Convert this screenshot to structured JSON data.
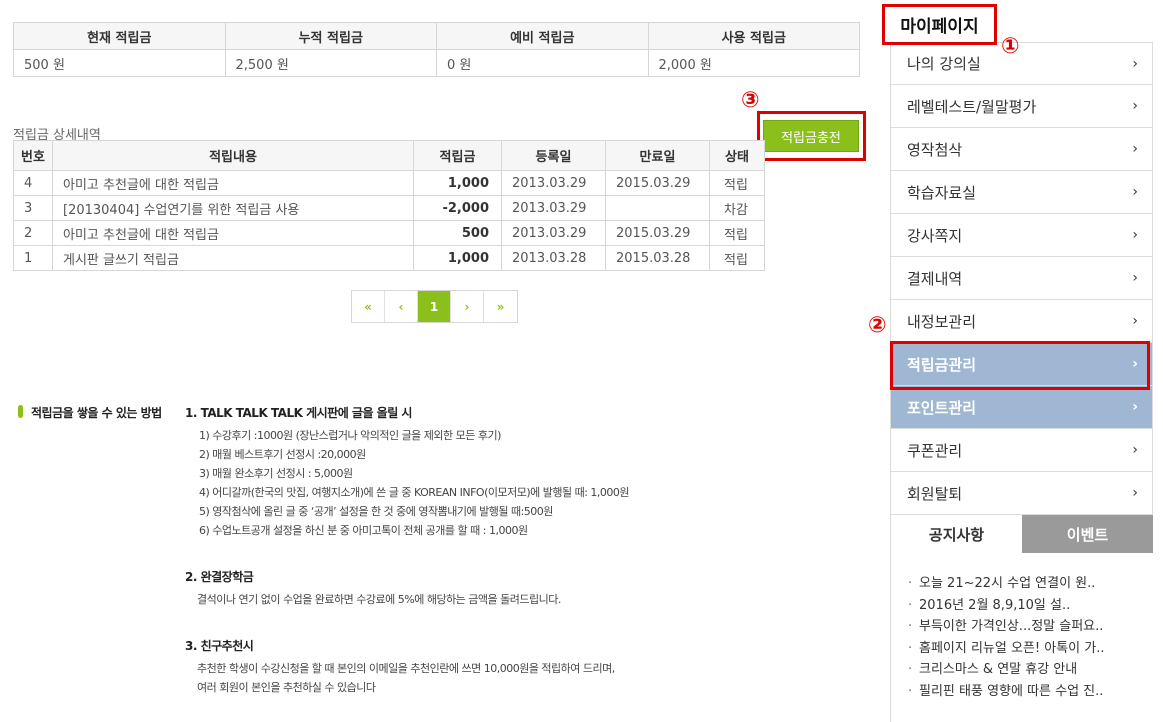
{
  "summary": {
    "headers": [
      "현재 적립금",
      "누적 적립금",
      "예비 적립금",
      "사용 적립금"
    ],
    "values": [
      "500 원",
      "2,500 원",
      "0 원",
      "2,000 원"
    ]
  },
  "detail": {
    "title": "적립금 상세내역",
    "charge_button": "적립금충전",
    "headers": [
      "번호",
      "적립내용",
      "적립금",
      "등록일",
      "만료일",
      "상태"
    ],
    "rows": [
      {
        "no": "4",
        "content": "아미고 추천글에 대한 적립금",
        "amount": "1,000",
        "reg": "2013.03.29",
        "exp": "2015.03.29",
        "status": "적립"
      },
      {
        "no": "3",
        "content": "[20130404] 수업연기를 위한 적립금 사용",
        "amount": "-2,000",
        "reg": "2013.03.29",
        "exp": "",
        "status": "차감"
      },
      {
        "no": "2",
        "content": "아미고 추천글에 대한 적립금",
        "amount": "500",
        "reg": "2013.03.29",
        "exp": "2015.03.29",
        "status": "적립"
      },
      {
        "no": "1",
        "content": "게시판 글쓰기 적립금",
        "amount": "1,000",
        "reg": "2013.03.28",
        "exp": "2015.03.28",
        "status": "적립"
      }
    ]
  },
  "pager": {
    "first": "«",
    "prev": "‹",
    "current": "1",
    "next": "›",
    "last": "»"
  },
  "info": {
    "heading": "적립금을 쌓을 수 있는 방법",
    "sec1_title": "1. TALK TALK TALK 게시판에 글을 올릴 시",
    "sec1_lines": [
      "1) 수강후기 :1000원 (장난스럽거나 악의적인 글을 제외한 모든 후기)",
      "2) 매월 베스트후기 선정시 :20,000원",
      "3) 매월 완소후기 선정시 : 5,000원",
      "4) 어디갈까(한국의 맛집, 여행지소개)에 쓴 글 중 KOREAN INFO(이모저모)에 발행될 때: 1,000원",
      "5) 영작첨삭에 올린 글 중 ‘공개’ 설정을 한 것 중에 영작뽐내기에 발행될 때:500원",
      "6) 수업노트공개 설정을 하신 분 중 아미고톡이 전체 공개를 할 때 : 1,000원"
    ],
    "sec2_title": "2. 완결장학금",
    "sec2_lines": [
      "결석이나 연기 없이 수업을 완료하면 수강료에 5%에 해당하는 금액을 돌려드립니다."
    ],
    "sec3_title": "3. 친구추천시",
    "sec3_lines": [
      "추천한 학생이 수강신청을 할 때 본인의 이메일을 추천인란에 쓰면 10,000원을 적립하여 드리며,",
      "여러 회원이 본인을 추천하실 수 있습니다"
    ]
  },
  "sidebar": {
    "title": "마이페이지",
    "annotations": [
      "①",
      "②",
      "③"
    ],
    "items": [
      {
        "label": "나의 강의실"
      },
      {
        "label": "레벨테스트/월말평가"
      },
      {
        "label": "영작첨삭"
      },
      {
        "label": "학습자료실"
      },
      {
        "label": "강사쪽지"
      },
      {
        "label": "결제내역"
      },
      {
        "label": "내정보관리"
      },
      {
        "label": "적립금관리"
      },
      {
        "label": "포인트관리"
      },
      {
        "label": "쿠폰관리"
      },
      {
        "label": "회원탈퇴"
      }
    ],
    "chevron": "›",
    "selected_color": "#9fb7d3"
  },
  "board": {
    "tabs": [
      "공지사항",
      "이벤트"
    ],
    "bullet": "·",
    "notices": [
      "오늘 21~22시 수업 연결이 원..",
      "2016년 2월 8,9,10일 설..",
      "부득이한 가격인상...정말 슬퍼요..",
      "홈페이지 리뉴얼 오픈! 아톡이 가..",
      "크리스마스 & 연말 휴강 안내",
      "필리핀 태풍 영향에 따른 수업 진.."
    ]
  },
  "colors": {
    "accent_green": "#8bbf1b",
    "annotation_red": "#e00000"
  }
}
